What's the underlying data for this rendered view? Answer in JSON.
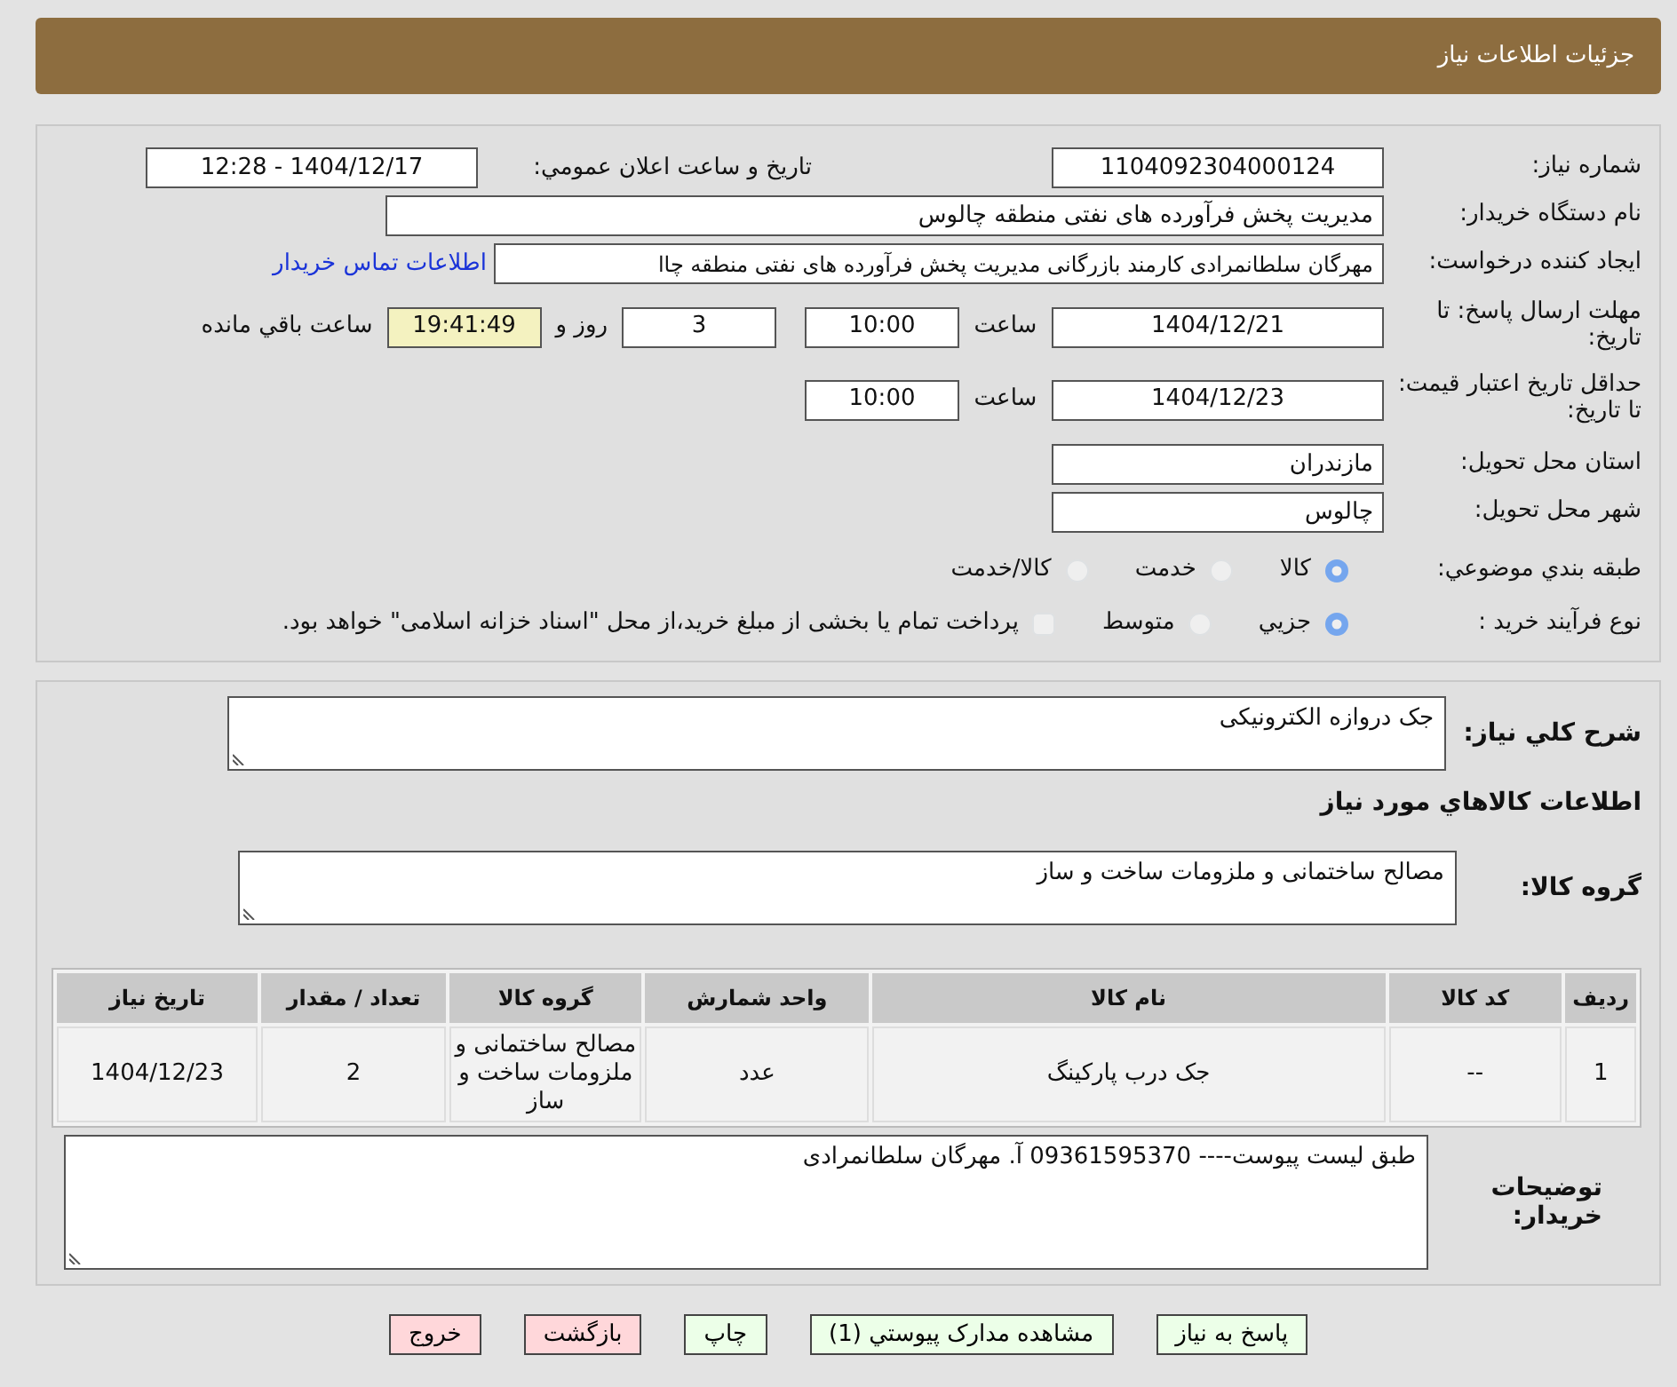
{
  "header": {
    "title": "جزئیات اطلاعات نیاز"
  },
  "need_number": {
    "label": "شماره نياز:",
    "value": "1104092304000124"
  },
  "announce": {
    "label": "تاريخ و ساعت اعلان عمومي:",
    "value": "1404/12/17 - 12:28"
  },
  "buyer_org": {
    "label": "نام دستگاه خريدار:",
    "value": "مديريت پخش فرآورده هاى نفتى منطقه چالوس"
  },
  "requester": {
    "label": "ايجاد کننده درخواست:",
    "value": "مهرگان سلطانمرادی کارمند بازرگانی مدیریت پخش فرآورده های نفتی منطقه چاا",
    "link": "اطلاعات تماس خريدار"
  },
  "deadline": {
    "label": "مهلت ارسال پاسخ: تا تاريخ:",
    "date": "1404/12/21",
    "time_label": "ساعت",
    "time": "10:00",
    "days": "3",
    "days_label": "روز و",
    "remaining": "19:41:49",
    "remaining_label": "ساعت باقي مانده"
  },
  "validity": {
    "label": "حداقل تاريخ اعتبار قيمت: تا تاريخ:",
    "date": "1404/12/23",
    "time_label": "ساعت",
    "time": "10:00"
  },
  "province": {
    "label": "استان محل تحويل:",
    "value": "مازندران"
  },
  "city": {
    "label": "شهر محل تحويل:",
    "value": "چالوس"
  },
  "category": {
    "label": "طبقه بندي موضوعي:",
    "options": [
      {
        "label": "کالا",
        "selected": true
      },
      {
        "label": "خدمت",
        "selected": false
      },
      {
        "label": "کالا/خدمت",
        "selected": false
      }
    ]
  },
  "process": {
    "label": "نوع فرآيند خريد :",
    "options": [
      {
        "label": "جزيي",
        "selected": true
      },
      {
        "label": "متوسط",
        "selected": false
      }
    ],
    "treasury": {
      "label": "پرداخت تمام يا بخشی از مبلغ خريد،از محل \"اسناد خزانه اسلامی\" خواهد بود.",
      "checked": false
    }
  },
  "description": {
    "label": "شرح کلي نياز:",
    "value": "جک دروازه الکترونیکی"
  },
  "goods_heading": "اطلاعات کالاهاي مورد نياز",
  "goods_group": {
    "label": "گروه کالا:",
    "value": "مصالح ساختمانی و ملزومات ساخت و ساز"
  },
  "table": {
    "columns": [
      "رديف",
      "کد کالا",
      "نام کالا",
      "واحد شمارش",
      "گروه کالا",
      "تعداد / مقدار",
      "تاريخ نياز"
    ],
    "rows": [
      [
        "1",
        "--",
        "جک درب پارکینگ",
        "عدد",
        "مصالح ساختمانی و ملزومات ساخت و ساز",
        "2",
        "1404/12/23"
      ]
    ]
  },
  "buyer_notes": {
    "label": "توضيحات خريدار:",
    "value": "طبق لیست پیوست---- 09361595370 آ. مهرگان سلطانمرادی"
  },
  "buttons": [
    {
      "label": "پاسخ به نياز",
      "kind": "accept"
    },
    {
      "label": "مشاهده مدارک پيوستي (1)",
      "kind": "accept"
    },
    {
      "label": "چاپ",
      "kind": "accept"
    },
    {
      "label": "بازگشت",
      "kind": "danger"
    },
    {
      "label": "خروج",
      "kind": "danger"
    }
  ]
}
